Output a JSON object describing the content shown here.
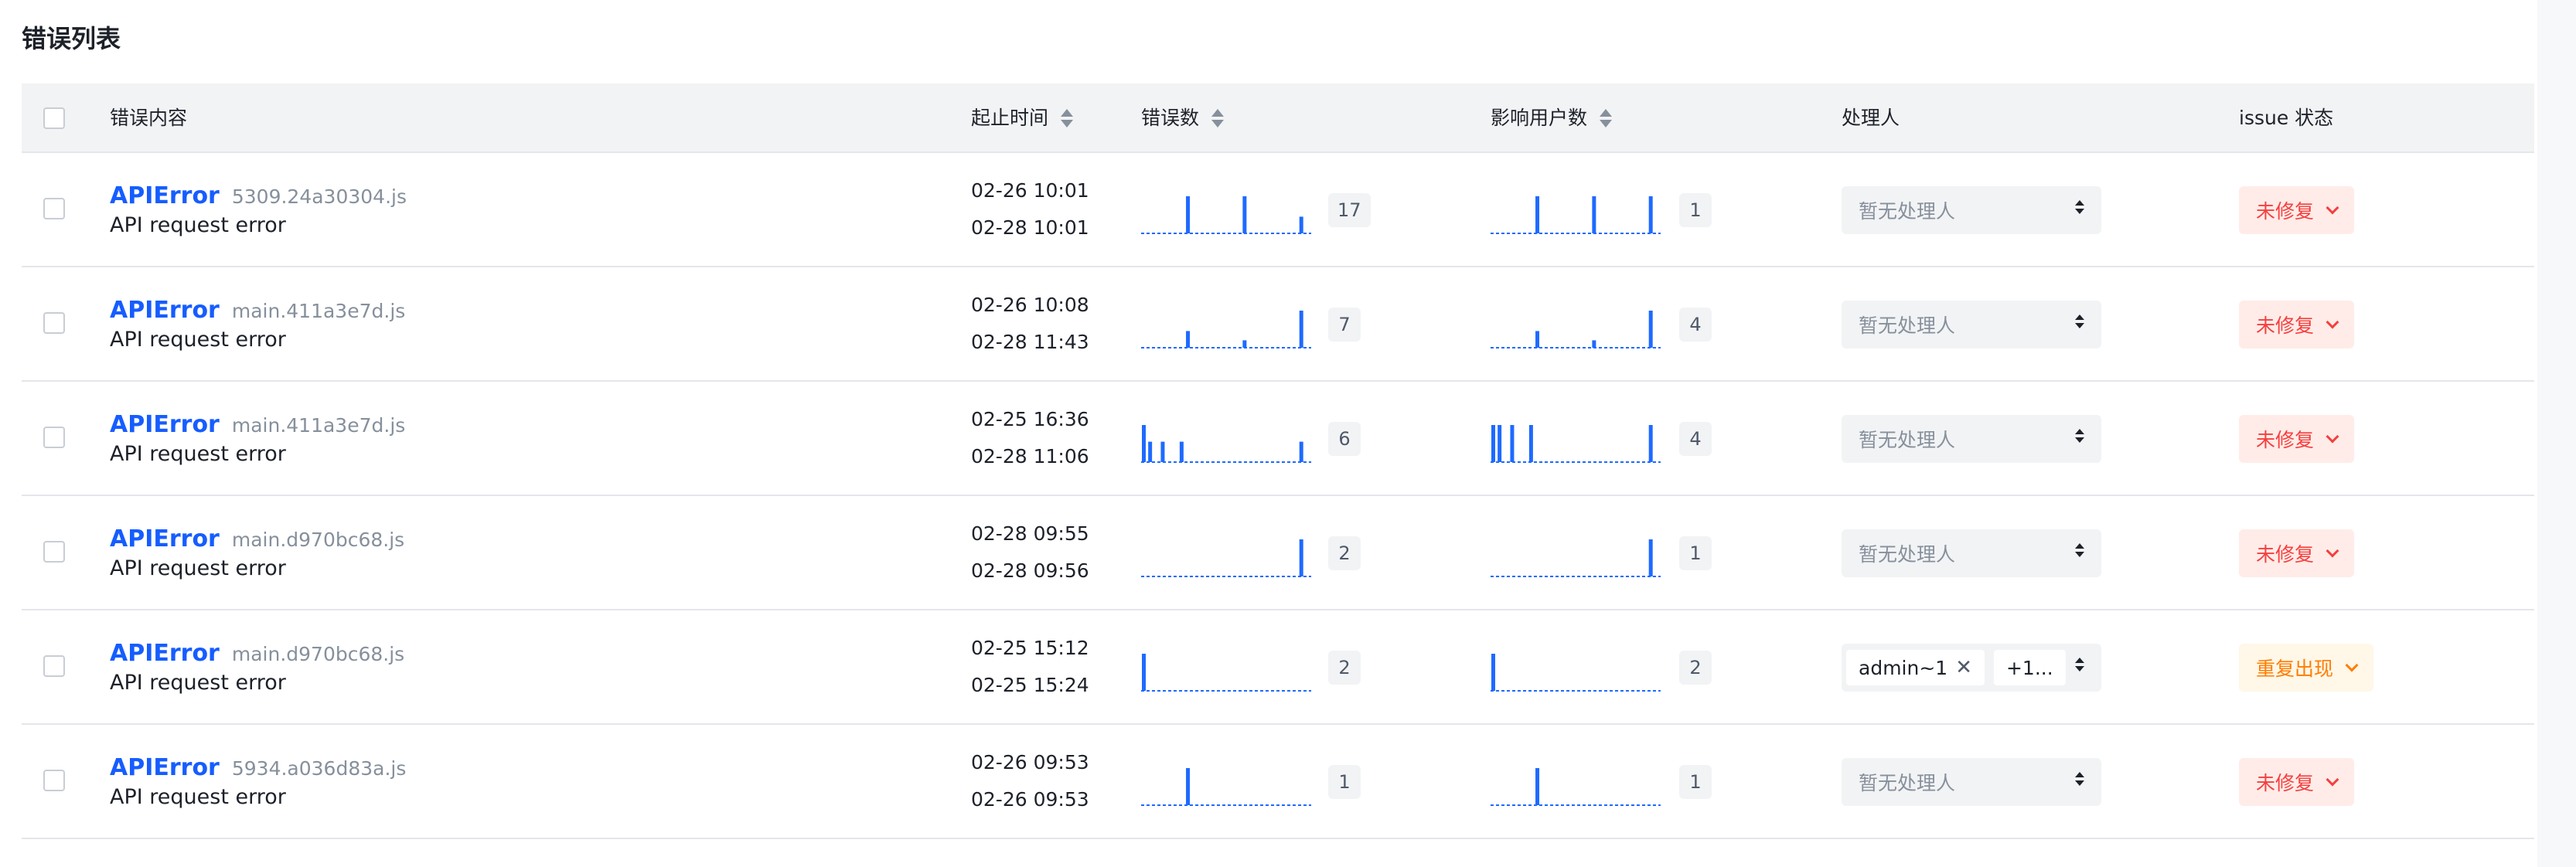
{
  "page_title": "错误列表",
  "colors": {
    "accent": "#165dff",
    "unfixed": "#f53f3f",
    "reopen": "#ff7d00",
    "spark": "#1e6aff"
  },
  "columns": {
    "content": "错误内容",
    "start_end_time": "起止时间",
    "error_count": "错误数",
    "affected_users": "影响用户数",
    "assignee": "处理人",
    "issue_status": "issue 状态"
  },
  "rows": [
    {
      "error_type": "APIError",
      "file": "5309.24a30304.js",
      "message": "API request error",
      "start": "02-26 10:01",
      "end": "02-28 10:01",
      "error_count": "17",
      "affected_users": "1",
      "error_spark": [
        0,
        0,
        0,
        0,
        0,
        0,
        0,
        1,
        0,
        0,
        0,
        0,
        0,
        0,
        0,
        0,
        1,
        0,
        0,
        0,
        0,
        0,
        0,
        0,
        0,
        0.45,
        0
      ],
      "user_spark": [
        0,
        0,
        0,
        0,
        0,
        0,
        0,
        1,
        0,
        0,
        0,
        0,
        0,
        0,
        0,
        0,
        1,
        0,
        0,
        0,
        0,
        0,
        0,
        0,
        0,
        1,
        0
      ],
      "assignee_placeholder": "暂无处理人",
      "assignee_tags": [],
      "status": "未修复",
      "status_kind": "unfixed"
    },
    {
      "error_type": "APIError",
      "file": "main.411a3e7d.js",
      "message": "API request error",
      "start": "02-26 10:08",
      "end": "02-28 11:43",
      "error_count": "7",
      "affected_users": "4",
      "error_spark": [
        0,
        0,
        0,
        0,
        0,
        0,
        0,
        0.45,
        0,
        0,
        0,
        0,
        0,
        0,
        0,
        0,
        0.2,
        0,
        0,
        0,
        0,
        0,
        0,
        0,
        0,
        1,
        0
      ],
      "user_spark": [
        0,
        0,
        0,
        0,
        0,
        0,
        0,
        0.45,
        0,
        0,
        0,
        0,
        0,
        0,
        0,
        0,
        0.2,
        0,
        0,
        0,
        0,
        0,
        0,
        0,
        0,
        1,
        0
      ],
      "assignee_placeholder": "暂无处理人",
      "assignee_tags": [],
      "status": "未修复",
      "status_kind": "unfixed"
    },
    {
      "error_type": "APIError",
      "file": "main.411a3e7d.js",
      "message": "API request error",
      "start": "02-25 16:36",
      "end": "02-28 11:06",
      "error_count": "6",
      "affected_users": "4",
      "error_spark": [
        1,
        0.55,
        0,
        0.55,
        0,
        0,
        0.55,
        0,
        0,
        0,
        0,
        0,
        0,
        0,
        0,
        0,
        0,
        0,
        0,
        0,
        0,
        0,
        0,
        0,
        0,
        0.55,
        0
      ],
      "user_spark": [
        1,
        1,
        0,
        1,
        0,
        0,
        1,
        0,
        0,
        0,
        0,
        0,
        0,
        0,
        0,
        0,
        0,
        0,
        0,
        0,
        0,
        0,
        0,
        0,
        0,
        1,
        0
      ],
      "assignee_placeholder": "暂无处理人",
      "assignee_tags": [],
      "status": "未修复",
      "status_kind": "unfixed"
    },
    {
      "error_type": "APIError",
      "file": "main.d970bc68.js",
      "message": "API request error",
      "start": "02-28 09:55",
      "end": "02-28 09:56",
      "error_count": "2",
      "affected_users": "1",
      "error_spark": [
        0,
        0,
        0,
        0,
        0,
        0,
        0,
        0,
        0,
        0,
        0,
        0,
        0,
        0,
        0,
        0,
        0,
        0,
        0,
        0,
        0,
        0,
        0,
        0,
        0,
        1,
        0
      ],
      "user_spark": [
        0,
        0,
        0,
        0,
        0,
        0,
        0,
        0,
        0,
        0,
        0,
        0,
        0,
        0,
        0,
        0,
        0,
        0,
        0,
        0,
        0,
        0,
        0,
        0,
        0,
        1,
        0
      ],
      "assignee_placeholder": "暂无处理人",
      "assignee_tags": [],
      "status": "未修复",
      "status_kind": "unfixed"
    },
    {
      "error_type": "APIError",
      "file": "main.d970bc68.js",
      "message": "API request error",
      "start": "02-25 15:12",
      "end": "02-25 15:24",
      "error_count": "2",
      "affected_users": "2",
      "error_spark": [
        1,
        0,
        0,
        0,
        0,
        0,
        0,
        0,
        0,
        0,
        0,
        0,
        0,
        0,
        0,
        0,
        0,
        0,
        0,
        0,
        0,
        0,
        0,
        0,
        0,
        0,
        0
      ],
      "user_spark": [
        1,
        0,
        0,
        0,
        0,
        0,
        0,
        0,
        0,
        0,
        0,
        0,
        0,
        0,
        0,
        0,
        0,
        0,
        0,
        0,
        0,
        0,
        0,
        0,
        0,
        0,
        0
      ],
      "assignee_placeholder": "",
      "assignee_tags": [
        "admin~1",
        "+1..."
      ],
      "status": "重复出现",
      "status_kind": "reopen"
    },
    {
      "error_type": "APIError",
      "file": "5934.a036d83a.js",
      "message": "API request error",
      "start": "02-26 09:53",
      "end": "02-26 09:53",
      "error_count": "1",
      "affected_users": "1",
      "error_spark": [
        0,
        0,
        0,
        0,
        0,
        0,
        0,
        1,
        0,
        0,
        0,
        0,
        0,
        0,
        0,
        0,
        0,
        0,
        0,
        0,
        0,
        0,
        0,
        0,
        0,
        0,
        0
      ],
      "user_spark": [
        0,
        0,
        0,
        0,
        0,
        0,
        0,
        1,
        0,
        0,
        0,
        0,
        0,
        0,
        0,
        0,
        0,
        0,
        0,
        0,
        0,
        0,
        0,
        0,
        0,
        0,
        0
      ],
      "assignee_placeholder": "暂无处理人",
      "assignee_tags": [],
      "status": "未修复",
      "status_kind": "unfixed"
    }
  ]
}
